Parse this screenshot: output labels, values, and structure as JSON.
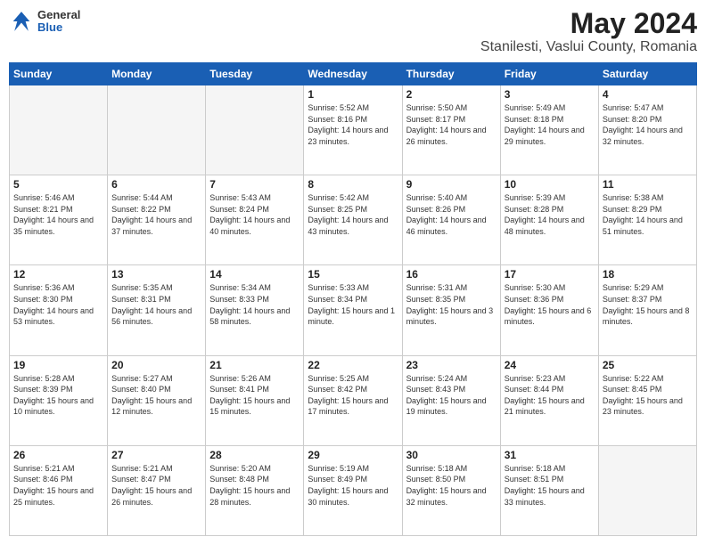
{
  "header": {
    "logo": {
      "general": "General",
      "blue": "Blue"
    },
    "month_year": "May 2024",
    "location": "Stanilesti, Vaslui County, Romania"
  },
  "days_of_week": [
    "Sunday",
    "Monday",
    "Tuesday",
    "Wednesday",
    "Thursday",
    "Friday",
    "Saturday"
  ],
  "weeks": [
    [
      {
        "day": "",
        "sunrise": "",
        "sunset": "",
        "daylight": ""
      },
      {
        "day": "",
        "sunrise": "",
        "sunset": "",
        "daylight": ""
      },
      {
        "day": "",
        "sunrise": "",
        "sunset": "",
        "daylight": ""
      },
      {
        "day": "1",
        "sunrise": "Sunrise: 5:52 AM",
        "sunset": "Sunset: 8:16 PM",
        "daylight": "Daylight: 14 hours and 23 minutes."
      },
      {
        "day": "2",
        "sunrise": "Sunrise: 5:50 AM",
        "sunset": "Sunset: 8:17 PM",
        "daylight": "Daylight: 14 hours and 26 minutes."
      },
      {
        "day": "3",
        "sunrise": "Sunrise: 5:49 AM",
        "sunset": "Sunset: 8:18 PM",
        "daylight": "Daylight: 14 hours and 29 minutes."
      },
      {
        "day": "4",
        "sunrise": "Sunrise: 5:47 AM",
        "sunset": "Sunset: 8:20 PM",
        "daylight": "Daylight: 14 hours and 32 minutes."
      }
    ],
    [
      {
        "day": "5",
        "sunrise": "Sunrise: 5:46 AM",
        "sunset": "Sunset: 8:21 PM",
        "daylight": "Daylight: 14 hours and 35 minutes."
      },
      {
        "day": "6",
        "sunrise": "Sunrise: 5:44 AM",
        "sunset": "Sunset: 8:22 PM",
        "daylight": "Daylight: 14 hours and 37 minutes."
      },
      {
        "day": "7",
        "sunrise": "Sunrise: 5:43 AM",
        "sunset": "Sunset: 8:24 PM",
        "daylight": "Daylight: 14 hours and 40 minutes."
      },
      {
        "day": "8",
        "sunrise": "Sunrise: 5:42 AM",
        "sunset": "Sunset: 8:25 PM",
        "daylight": "Daylight: 14 hours and 43 minutes."
      },
      {
        "day": "9",
        "sunrise": "Sunrise: 5:40 AM",
        "sunset": "Sunset: 8:26 PM",
        "daylight": "Daylight: 14 hours and 46 minutes."
      },
      {
        "day": "10",
        "sunrise": "Sunrise: 5:39 AM",
        "sunset": "Sunset: 8:28 PM",
        "daylight": "Daylight: 14 hours and 48 minutes."
      },
      {
        "day": "11",
        "sunrise": "Sunrise: 5:38 AM",
        "sunset": "Sunset: 8:29 PM",
        "daylight": "Daylight: 14 hours and 51 minutes."
      }
    ],
    [
      {
        "day": "12",
        "sunrise": "Sunrise: 5:36 AM",
        "sunset": "Sunset: 8:30 PM",
        "daylight": "Daylight: 14 hours and 53 minutes."
      },
      {
        "day": "13",
        "sunrise": "Sunrise: 5:35 AM",
        "sunset": "Sunset: 8:31 PM",
        "daylight": "Daylight: 14 hours and 56 minutes."
      },
      {
        "day": "14",
        "sunrise": "Sunrise: 5:34 AM",
        "sunset": "Sunset: 8:33 PM",
        "daylight": "Daylight: 14 hours and 58 minutes."
      },
      {
        "day": "15",
        "sunrise": "Sunrise: 5:33 AM",
        "sunset": "Sunset: 8:34 PM",
        "daylight": "Daylight: 15 hours and 1 minute."
      },
      {
        "day": "16",
        "sunrise": "Sunrise: 5:31 AM",
        "sunset": "Sunset: 8:35 PM",
        "daylight": "Daylight: 15 hours and 3 minutes."
      },
      {
        "day": "17",
        "sunrise": "Sunrise: 5:30 AM",
        "sunset": "Sunset: 8:36 PM",
        "daylight": "Daylight: 15 hours and 6 minutes."
      },
      {
        "day": "18",
        "sunrise": "Sunrise: 5:29 AM",
        "sunset": "Sunset: 8:37 PM",
        "daylight": "Daylight: 15 hours and 8 minutes."
      }
    ],
    [
      {
        "day": "19",
        "sunrise": "Sunrise: 5:28 AM",
        "sunset": "Sunset: 8:39 PM",
        "daylight": "Daylight: 15 hours and 10 minutes."
      },
      {
        "day": "20",
        "sunrise": "Sunrise: 5:27 AM",
        "sunset": "Sunset: 8:40 PM",
        "daylight": "Daylight: 15 hours and 12 minutes."
      },
      {
        "day": "21",
        "sunrise": "Sunrise: 5:26 AM",
        "sunset": "Sunset: 8:41 PM",
        "daylight": "Daylight: 15 hours and 15 minutes."
      },
      {
        "day": "22",
        "sunrise": "Sunrise: 5:25 AM",
        "sunset": "Sunset: 8:42 PM",
        "daylight": "Daylight: 15 hours and 17 minutes."
      },
      {
        "day": "23",
        "sunrise": "Sunrise: 5:24 AM",
        "sunset": "Sunset: 8:43 PM",
        "daylight": "Daylight: 15 hours and 19 minutes."
      },
      {
        "day": "24",
        "sunrise": "Sunrise: 5:23 AM",
        "sunset": "Sunset: 8:44 PM",
        "daylight": "Daylight: 15 hours and 21 minutes."
      },
      {
        "day": "25",
        "sunrise": "Sunrise: 5:22 AM",
        "sunset": "Sunset: 8:45 PM",
        "daylight": "Daylight: 15 hours and 23 minutes."
      }
    ],
    [
      {
        "day": "26",
        "sunrise": "Sunrise: 5:21 AM",
        "sunset": "Sunset: 8:46 PM",
        "daylight": "Daylight: 15 hours and 25 minutes."
      },
      {
        "day": "27",
        "sunrise": "Sunrise: 5:21 AM",
        "sunset": "Sunset: 8:47 PM",
        "daylight": "Daylight: 15 hours and 26 minutes."
      },
      {
        "day": "28",
        "sunrise": "Sunrise: 5:20 AM",
        "sunset": "Sunset: 8:48 PM",
        "daylight": "Daylight: 15 hours and 28 minutes."
      },
      {
        "day": "29",
        "sunrise": "Sunrise: 5:19 AM",
        "sunset": "Sunset: 8:49 PM",
        "daylight": "Daylight: 15 hours and 30 minutes."
      },
      {
        "day": "30",
        "sunrise": "Sunrise: 5:18 AM",
        "sunset": "Sunset: 8:50 PM",
        "daylight": "Daylight: 15 hours and 32 minutes."
      },
      {
        "day": "31",
        "sunrise": "Sunrise: 5:18 AM",
        "sunset": "Sunset: 8:51 PM",
        "daylight": "Daylight: 15 hours and 33 minutes."
      },
      {
        "day": "",
        "sunrise": "",
        "sunset": "",
        "daylight": ""
      }
    ]
  ]
}
